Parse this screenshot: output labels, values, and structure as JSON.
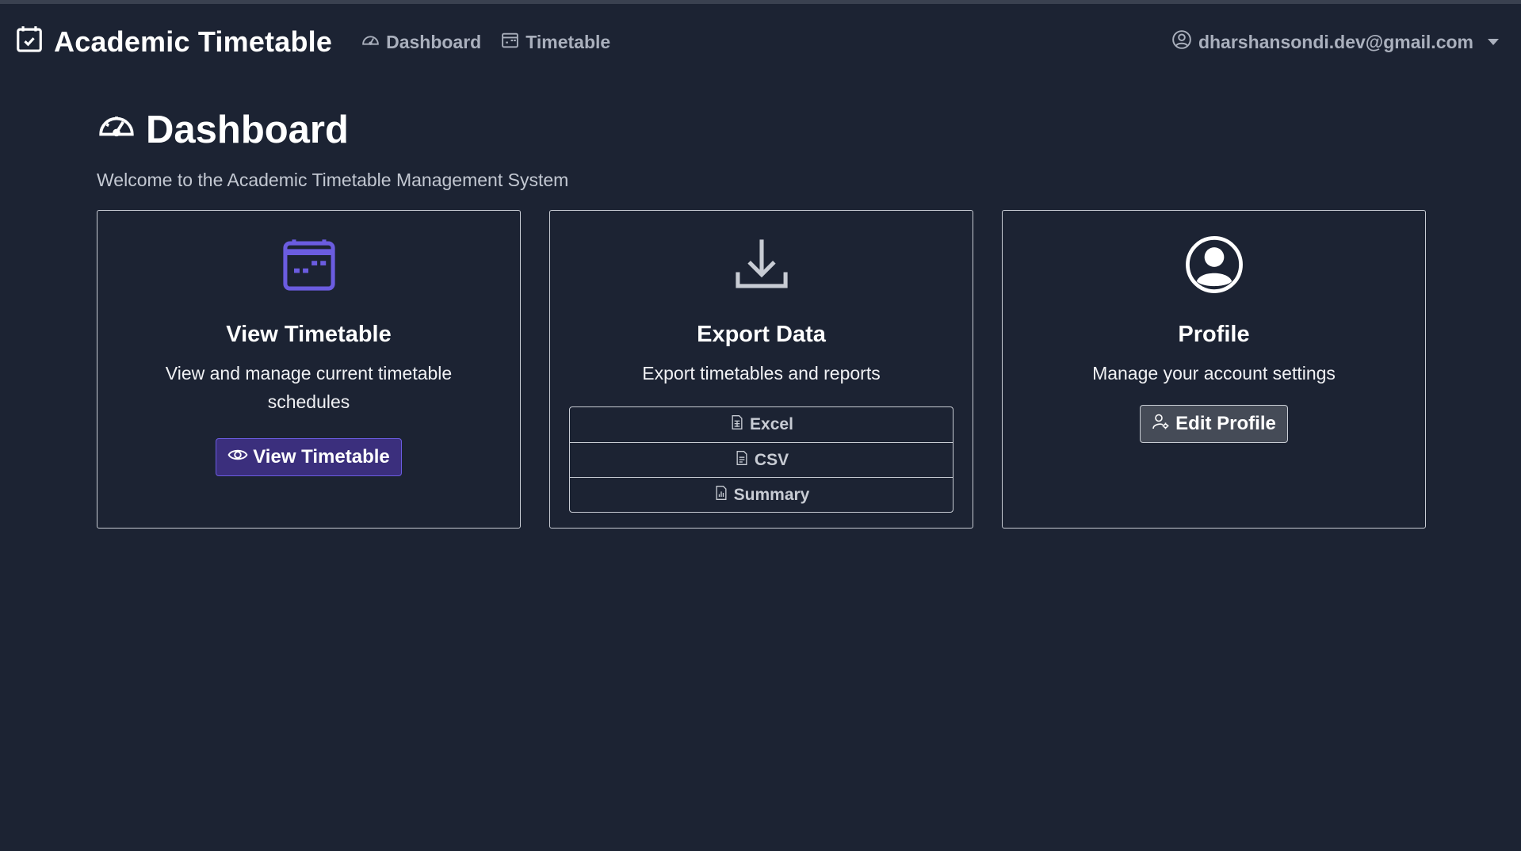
{
  "navbar": {
    "brand": "Academic Timetable",
    "brand_icon": "calendar-check-icon",
    "links": [
      {
        "label": "Dashboard",
        "icon": "speedometer-icon"
      },
      {
        "label": "Timetable",
        "icon": "calendar-icon"
      }
    ],
    "user_email": "dharshansondi.dev@gmail.com",
    "user_icon": "person-circle-icon"
  },
  "page": {
    "title": "Dashboard",
    "subtitle": "Welcome to the Academic Timetable Management System"
  },
  "cards": {
    "view_timetable": {
      "title": "View Timetable",
      "text": "View and manage current timetable schedules",
      "button_label": "View Timetable",
      "icon": "calendar-week-icon",
      "icon_color": "#6b5ce0"
    },
    "export_data": {
      "title": "Export Data",
      "text": "Export timetables and reports",
      "icon": "download-icon",
      "options": [
        {
          "label": "Excel",
          "icon": "file-spreadsheet-icon"
        },
        {
          "label": "CSV",
          "icon": "file-text-icon"
        },
        {
          "label": "Summary",
          "icon": "file-chart-icon"
        }
      ]
    },
    "profile": {
      "title": "Profile",
      "text": "Manage your account settings",
      "button_label": "Edit Profile",
      "icon": "person-circle-icon"
    }
  },
  "colors": {
    "background": "#1c2333",
    "accent": "#6b5ce0",
    "primary_button": "#3b2f7d"
  }
}
